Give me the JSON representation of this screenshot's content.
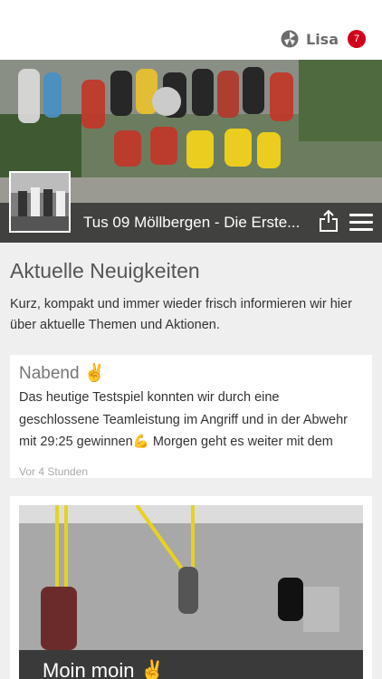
{
  "header": {
    "user_name": "Lisa",
    "notification_count": "7",
    "team_title": "Tus 09 Möllbergen - Die Erste...",
    "logo_icon": "hexagon-logo-icon",
    "share_icon": "share-icon",
    "menu_icon": "hamburger-menu-icon"
  },
  "section": {
    "title": "Aktuelle Neuigkeiten",
    "description": "Kurz, kompakt und immer wieder frisch informieren wir hier über aktuelle Themen und Aktionen."
  },
  "posts": [
    {
      "title": "Nabend ✌️",
      "body": "Das heutige Testspiel konnten wir durch eine geschlossene Teamleistung im Angriff und in der Abwehr mit 29:25 gewinnen💪 Morgen geht es weiter mit dem Brötje-Cup in",
      "time": "Vor 4 Stunden"
    },
    {
      "title": "Moin moin ✌️"
    }
  ],
  "colors": {
    "badge": "#d0021b",
    "background": "#efefef"
  }
}
